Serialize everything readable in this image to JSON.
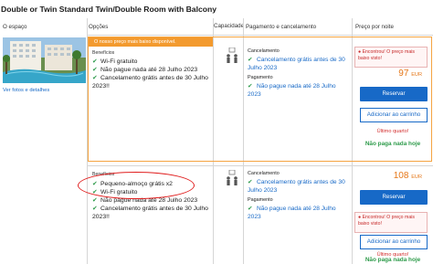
{
  "room": {
    "title": "Double or Twin Standard Twin/Double Room with Balcony"
  },
  "columns": {
    "space": "O espaço",
    "options": "Opções",
    "capacity": "Capacidade",
    "payment": "Pagamento e cancelamento",
    "price": "Preço por noite"
  },
  "room_info": {
    "photos_link": "Ver fotos e detalhes"
  },
  "offers": [
    {
      "badge": "O nosso preço mais baixo disponível.",
      "benefits_title": "Benefícios",
      "benefits": [
        "Wi-Fi gratuito",
        "Não pague nada até 28 Julho 2023",
        "Cancelamento grátis antes de 30 Julho 2023!!"
      ],
      "cancellation_label": "Cancelamento",
      "cancellation_text": "Cancelamento grátis antes de 30 Julho 2023",
      "payment_label": "Pagamento",
      "payment_text": "Não pague nada até 28 Julho 2023",
      "promo": "Encontrou! O preço mais baixo visto!",
      "price": "97",
      "currency": "EUR",
      "reserve": "Reservar",
      "add_cart": "Adicionar ao carrinho",
      "last_room": "Último quarto!",
      "no_pay": "Não paga nada hoje"
    },
    {
      "benefits_title": "Benefícios",
      "benefits": [
        "Pequeno-almoço grátis x2",
        "Wi-Fi gratuito",
        "Não pague nada até 28 Julho 2023",
        "Cancelamento grátis antes de 30 Julho 2023!!"
      ],
      "cancellation_label": "Cancelamento",
      "cancellation_text": "Cancelamento grátis antes de 30 Julho 2023",
      "payment_label": "Pagamento",
      "payment_text": "Não pague nada até 28 Julho 2023",
      "promo": "Encontrou! O preço mais baixo visto!",
      "price": "108",
      "currency": "EUR",
      "reserve": "Reservar",
      "add_cart": "Adicionar ao carrinho",
      "last_room": "Último quarto!",
      "no_pay": "Não paga nada hoje"
    }
  ],
  "colors": {
    "accent_orange": "#f39a2e",
    "link_blue": "#1769c7",
    "success_green": "#2e9b4b",
    "alert_red": "#d32f2f"
  }
}
